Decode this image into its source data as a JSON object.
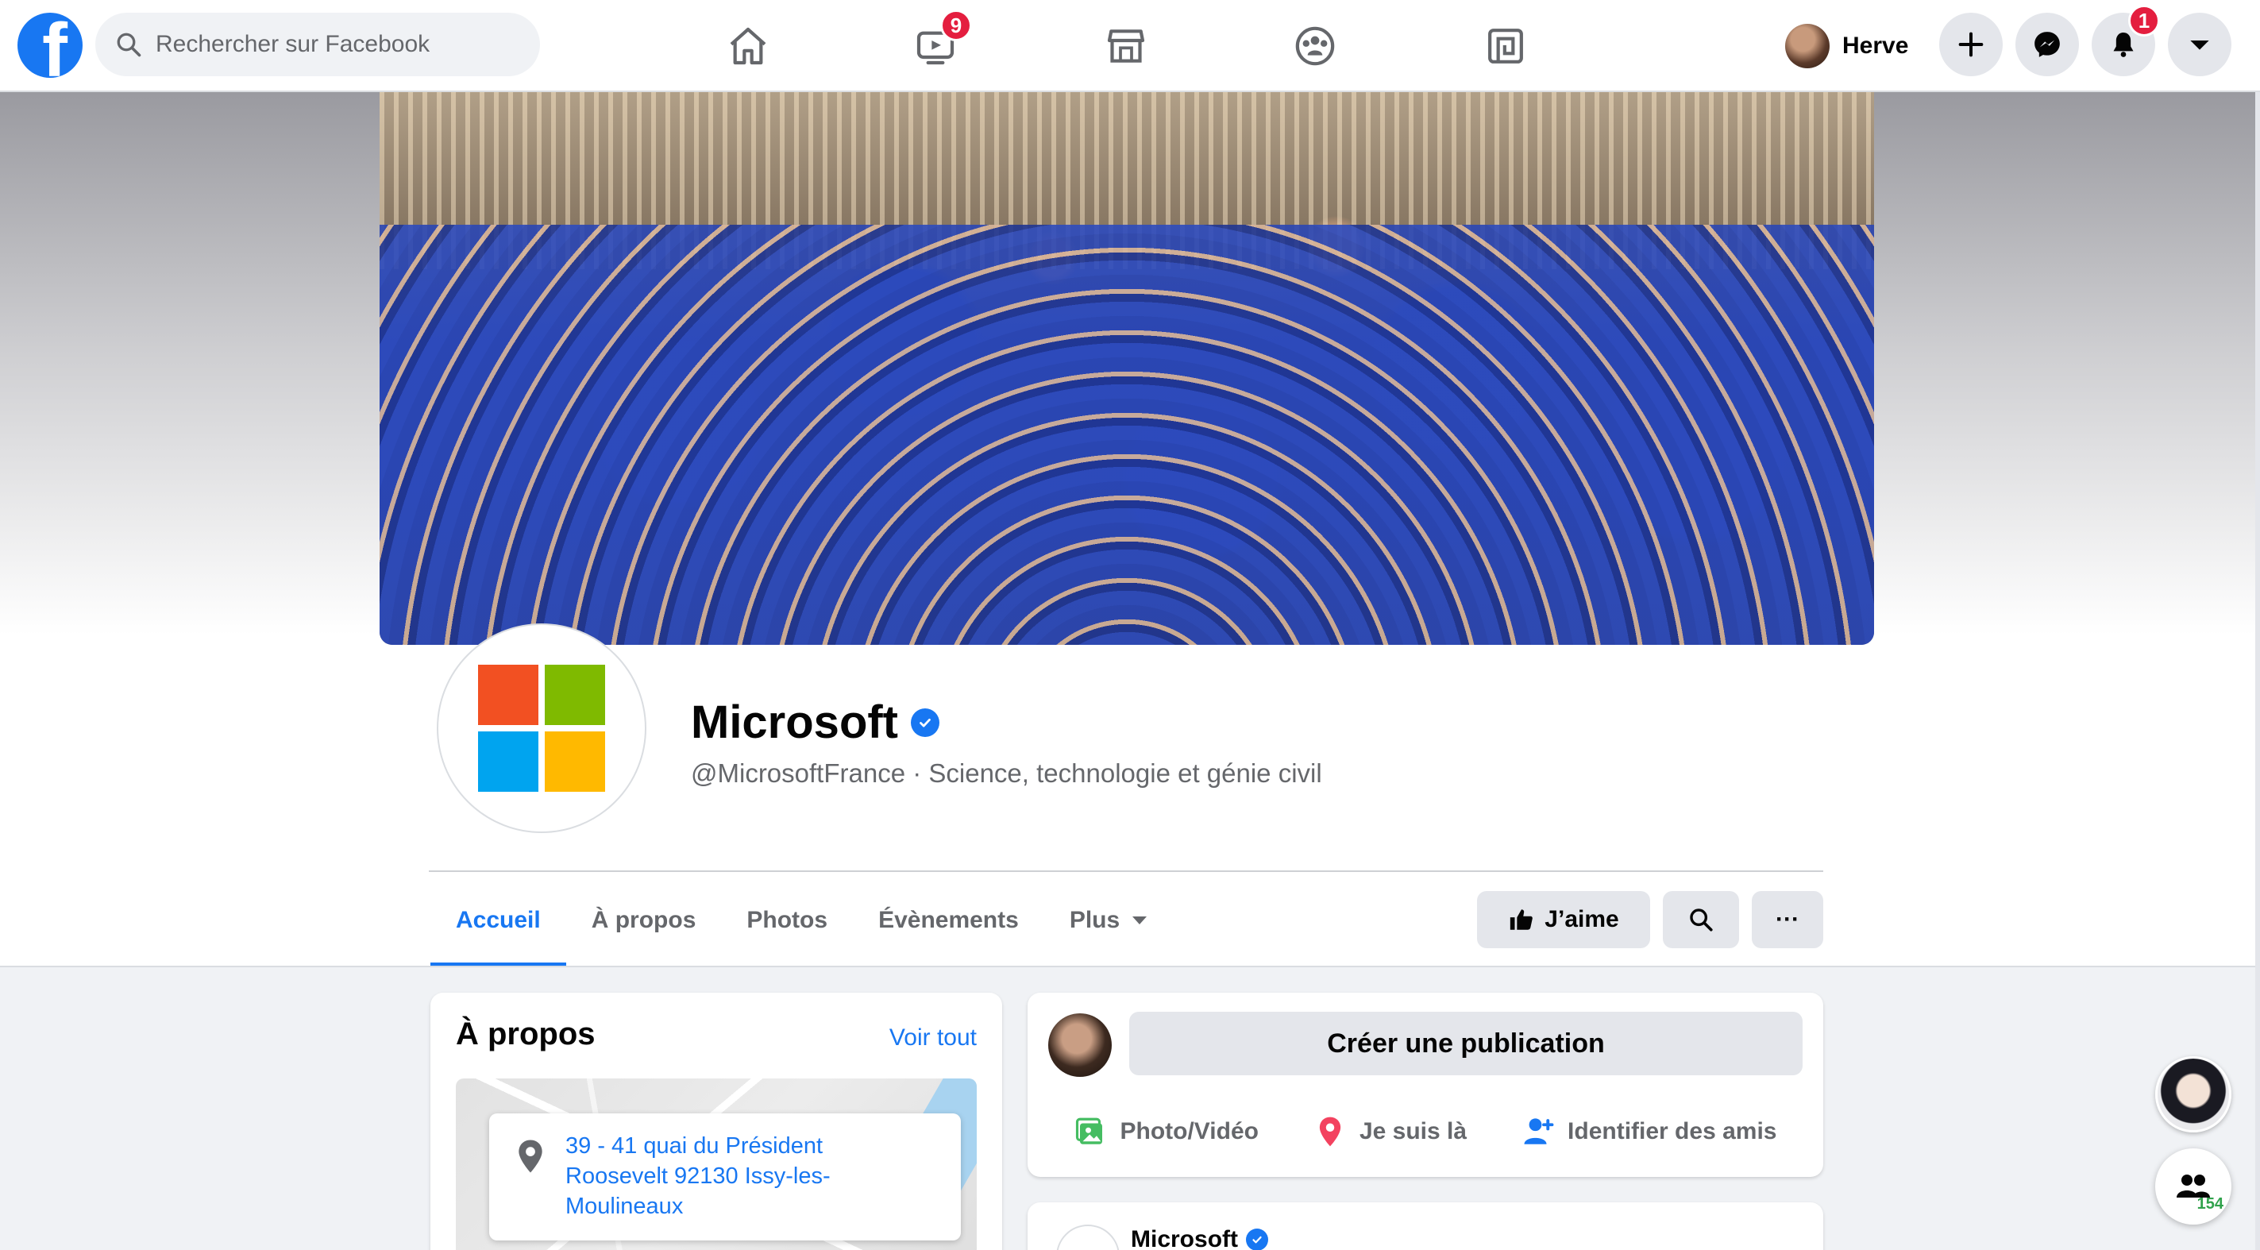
{
  "topbar": {
    "search_placeholder": "Rechercher sur Facebook",
    "nav": [
      {
        "name": "home-icon",
        "badge": ""
      },
      {
        "name": "watch-icon",
        "badge": "9"
      },
      {
        "name": "marketplace-icon",
        "badge": ""
      },
      {
        "name": "groups-icon",
        "badge": ""
      },
      {
        "name": "gaming-icon",
        "badge": ""
      }
    ],
    "profile_name": "Herve",
    "notifications_badge": "1"
  },
  "page": {
    "name": "Microsoft",
    "subtitle": "@MicrosoftFrance · Science, technologie et génie civil",
    "logo_colors": [
      "#f25022",
      "#7fba00",
      "#00a4ef",
      "#ffb900"
    ],
    "tabs": [
      {
        "label": "Accueil",
        "active": true
      },
      {
        "label": "À propos",
        "active": false
      },
      {
        "label": "Photos",
        "active": false
      },
      {
        "label": "Évènements",
        "active": false
      },
      {
        "label": "Plus",
        "active": false
      }
    ],
    "like_label": "J’aime",
    "more_label": "···"
  },
  "about": {
    "title": "À propos",
    "see_all": "Voir tout",
    "address": "39 - 41 quai du Président Roosevelt 92130 Issy-les-Moulineaux"
  },
  "composer": {
    "create_label": "Créer une publication",
    "actions": [
      {
        "label": "Photo/Vidéo",
        "icon": "photo-video-icon",
        "color": "#45bd62"
      },
      {
        "label": "Je suis là",
        "icon": "location-pin-icon",
        "color": "#f3425f"
      },
      {
        "label": "Identifier des amis",
        "icon": "tag-friends-icon",
        "color": "#1877f2"
      }
    ]
  },
  "post": {
    "author": "Microsoft",
    "menu_label": "···"
  },
  "contacts": {
    "count": "154"
  },
  "colors": {
    "brand": "#1877f2",
    "badge": "#e41e3f"
  }
}
